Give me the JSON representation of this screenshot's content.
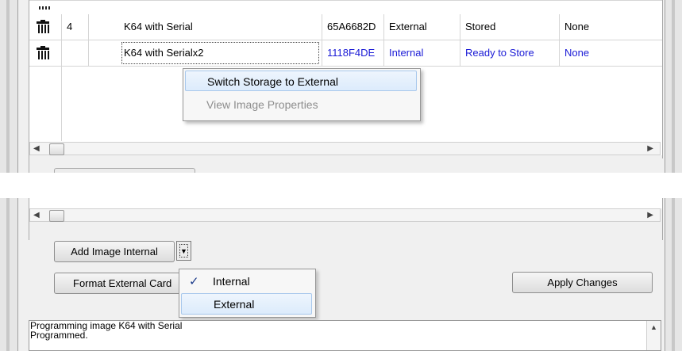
{
  "grid": {
    "rows": [
      {
        "index": "4",
        "name": "K64 with Serial",
        "id": "65A6682D",
        "storage": "External",
        "status": "Stored",
        "extra": "None"
      },
      {
        "index": "",
        "name": "K64 with Serialx2",
        "id": "1118F4DE",
        "storage": "Internal",
        "status": "Ready to Store",
        "extra": "None"
      }
    ]
  },
  "context_menu": {
    "items": [
      "Switch Storage to External",
      "View Image Properties"
    ]
  },
  "buttons": {
    "add_image": "Add Image Internal",
    "format_card": "Format External Card",
    "apply": "Apply Changes"
  },
  "dropdown": {
    "items": [
      "Internal",
      "External"
    ],
    "checked": "Internal"
  },
  "log": {
    "lines": [
      "Programming image K64 with Serial",
      "Programmed."
    ]
  },
  "colors": {
    "link": "#1a1ad6",
    "highlight": "#dcebfc"
  }
}
